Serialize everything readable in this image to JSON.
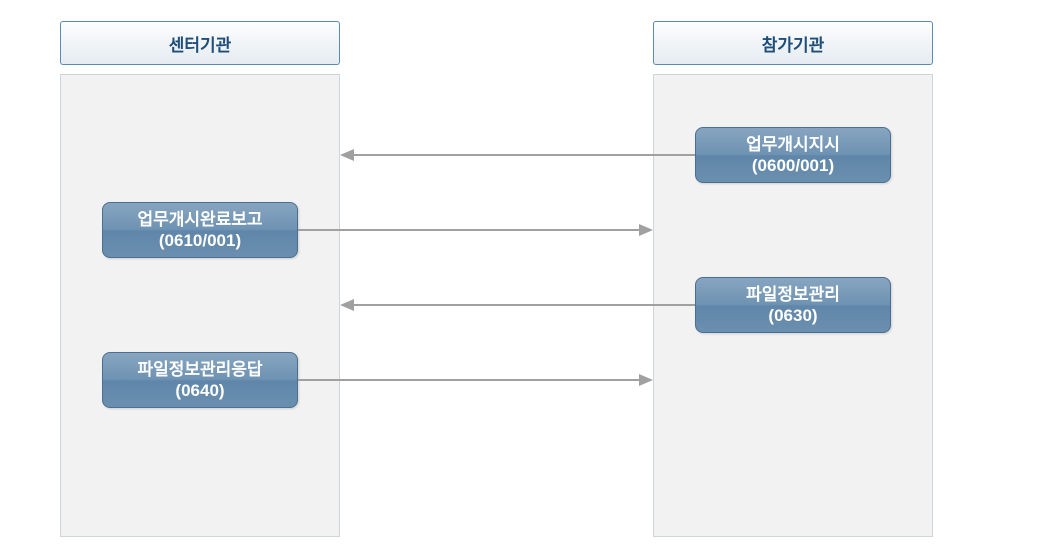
{
  "columns": {
    "left": {
      "title": "센터기관"
    },
    "right": {
      "title": "참가기관"
    }
  },
  "nodes": {
    "n1": {
      "line1": "업무개시지시",
      "line2": "(0600/001)"
    },
    "n2": {
      "line1": "업무개시완료보고",
      "line2": "(0610/001)"
    },
    "n3": {
      "line1": "파일정보관리",
      "line2": "(0630)"
    },
    "n4": {
      "line1": "파일정보관리응답",
      "line2": "(0640)"
    }
  }
}
